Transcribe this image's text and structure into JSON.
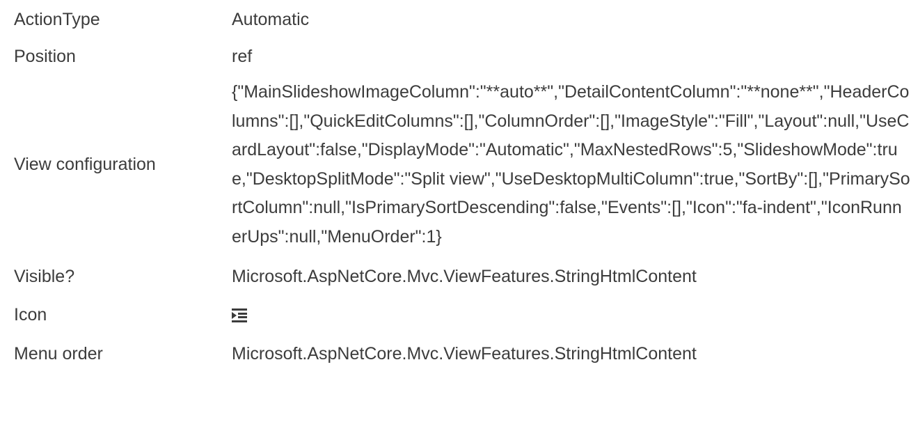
{
  "properties": {
    "action_type": {
      "label": "ActionType",
      "value": "Automatic"
    },
    "position": {
      "label": "Position",
      "value": "ref"
    },
    "view_configuration": {
      "label": "View configuration",
      "value": "{\"MainSlideshowImageColumn\":\"**auto**\",\"DetailContentColumn\":\"**none**\",\"HeaderColumns\":[],\"QuickEditColumns\":[],\"ColumnOrder\":[],\"ImageStyle\":\"Fill\",\"Layout\":null,\"UseCardLayout\":false,\"DisplayMode\":\"Automatic\",\"MaxNestedRows\":5,\"SlideshowMode\":true,\"DesktopSplitMode\":\"Split view\",\"UseDesktopMultiColumn\":true,\"SortBy\":[],\"PrimarySortColumn\":null,\"IsPrimarySortDescending\":false,\"Events\":[],\"Icon\":\"fa-indent\",\"IconRunnerUps\":null,\"MenuOrder\":1}"
    },
    "visible": {
      "label": "Visible?",
      "value": "Microsoft.AspNetCore.Mvc.ViewFeatures.StringHtmlContent"
    },
    "icon": {
      "label": "Icon",
      "icon_name": "indent-icon"
    },
    "menu_order": {
      "label": "Menu order",
      "value": "Microsoft.AspNetCore.Mvc.ViewFeatures.StringHtmlContent"
    }
  },
  "colors": {
    "text": "#3c3c3c",
    "background": "#ffffff"
  }
}
